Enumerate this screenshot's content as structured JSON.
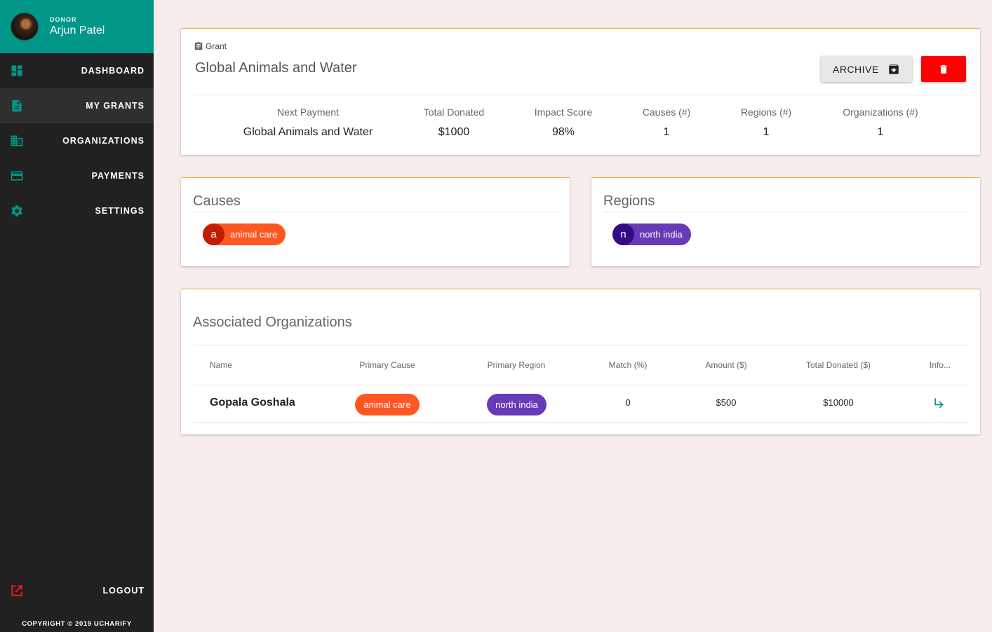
{
  "user": {
    "role": "DONOR",
    "name": "Arjun Patel"
  },
  "nav": [
    {
      "label": "DASHBOARD",
      "icon": "dashboard-icon"
    },
    {
      "label": "MY GRANTS",
      "icon": "document-icon",
      "active": true
    },
    {
      "label": "ORGANIZATIONS",
      "icon": "building-icon"
    },
    {
      "label": "PAYMENTS",
      "icon": "credit-card-icon"
    },
    {
      "label": "SETTINGS",
      "icon": "gear-icon"
    }
  ],
  "logout_label": "LOGOUT",
  "copyright": "COPYRIGHT © 2019 UCHARIFY",
  "grant": {
    "label": "Grant",
    "title": "Global Animals and Water",
    "archive_label": "ARCHIVE",
    "stats": [
      {
        "label": "Next Payment",
        "value": "Global Animals and Water"
      },
      {
        "label": "Total Donated",
        "value": "$1000"
      },
      {
        "label": "Impact Score",
        "value": "98%"
      },
      {
        "label": "Causes (#)",
        "value": "1"
      },
      {
        "label": "Regions (#)",
        "value": "1"
      },
      {
        "label": "Organizations (#)",
        "value": "1"
      }
    ]
  },
  "causes": {
    "title": "Causes",
    "chip": {
      "initial": "a",
      "label": "animal care"
    }
  },
  "regions": {
    "title": "Regions",
    "chip": {
      "initial": "n",
      "label": "north india"
    }
  },
  "organizations": {
    "title": "Associated Organizations",
    "columns": [
      "Name",
      "Primary Cause",
      "Primary Region",
      "Match (%)",
      "Amount ($)",
      "Total Donated ($)",
      "Info..."
    ],
    "rows": [
      {
        "name": "Gopala Goshala",
        "cause": "animal care",
        "region": "north india",
        "match": "0",
        "amount": "$500",
        "total": "$10000"
      }
    ]
  },
  "colors": {
    "sidebar": "#212121",
    "accent": "#009688",
    "background": "#f7eded",
    "cause": "#ff5722",
    "region": "#673ab7",
    "delete": "#ff0000"
  }
}
